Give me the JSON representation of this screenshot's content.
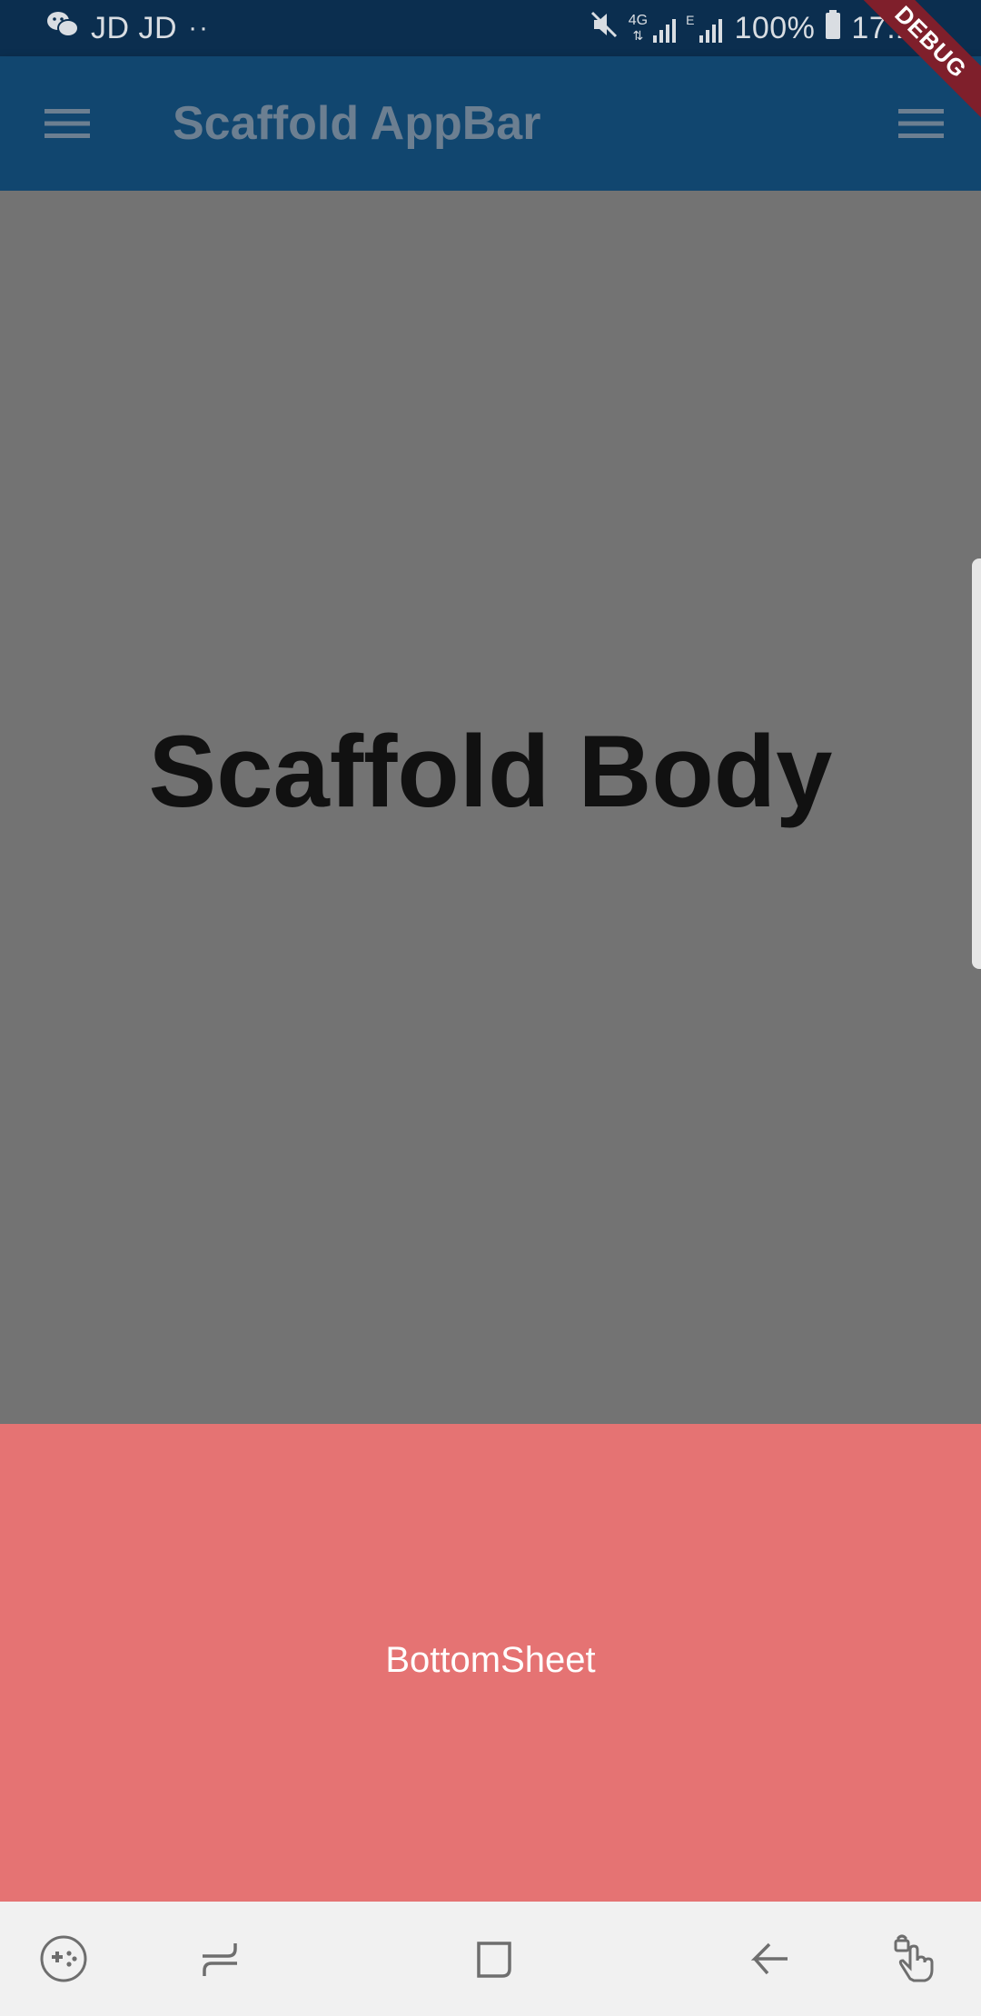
{
  "status_bar": {
    "left_text": "JD JD",
    "dots": "··",
    "network_4g": "4G",
    "network_e": "E",
    "battery_percent": "100%",
    "time": "17:13",
    "icons": [
      "wechat-icon",
      "mute-icon",
      "signal-icon",
      "battery-icon"
    ]
  },
  "app_bar": {
    "title": "Scaffold AppBar",
    "leading_icon": "menu-icon",
    "trailing_icon": "menu-icon",
    "background": "#11466f",
    "title_color": "#6c7f91"
  },
  "debug_banner": {
    "label": "DEBUG",
    "color": "#7f1f2b"
  },
  "body": {
    "text": "Scaffold Body",
    "background": "#737373"
  },
  "bottom_sheet": {
    "label": "BottomSheet",
    "background": "#e57373"
  },
  "nav_bar": {
    "items": [
      "game-tools-icon",
      "recent-apps-icon",
      "home-icon",
      "back-icon",
      "touch-lock-icon"
    ]
  }
}
